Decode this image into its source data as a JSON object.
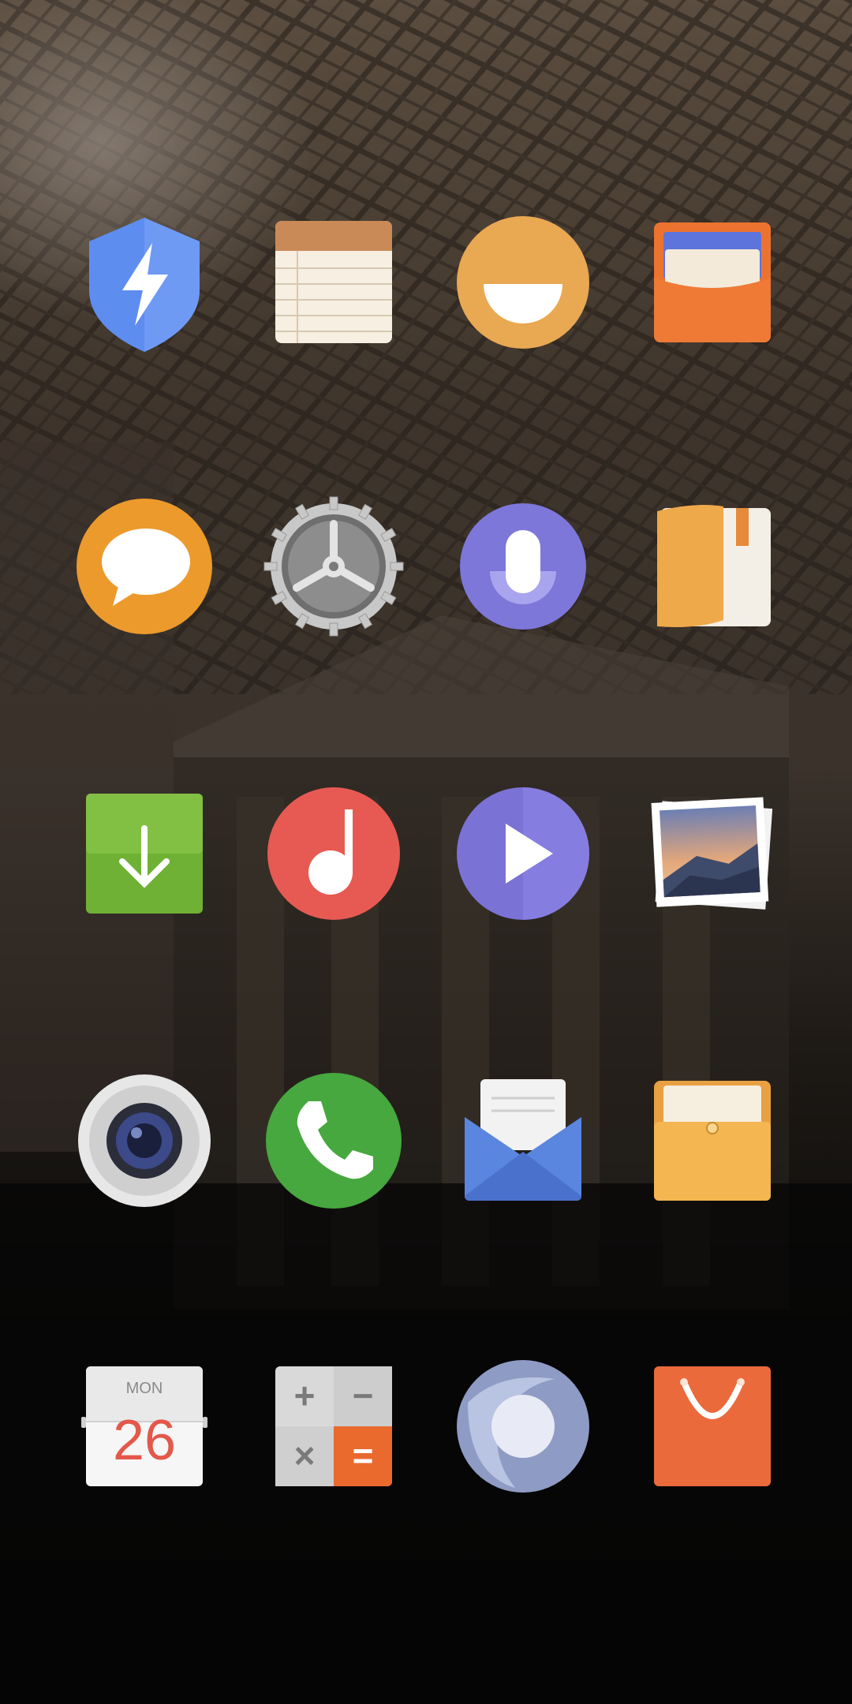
{
  "apps": [
    {
      "id": "security",
      "icon": "shield-lightning-icon"
    },
    {
      "id": "notes",
      "icon": "notepad-icon"
    },
    {
      "id": "theme-smile",
      "icon": "smile-icon"
    },
    {
      "id": "wallet",
      "icon": "wallet-cards-icon"
    },
    {
      "id": "messages",
      "icon": "speech-bubble-icon"
    },
    {
      "id": "settings",
      "icon": "gear-icon"
    },
    {
      "id": "voice-assistant",
      "icon": "microphone-icon"
    },
    {
      "id": "reader",
      "icon": "book-icon"
    },
    {
      "id": "downloads",
      "icon": "download-arrow-icon"
    },
    {
      "id": "music",
      "icon": "music-note-icon"
    },
    {
      "id": "video",
      "icon": "play-icon"
    },
    {
      "id": "gallery",
      "icon": "photo-stack-icon"
    },
    {
      "id": "camera",
      "icon": "camera-lens-icon"
    },
    {
      "id": "phone",
      "icon": "phone-handset-icon"
    },
    {
      "id": "email",
      "icon": "envelope-icon"
    },
    {
      "id": "file-manager",
      "icon": "folder-envelope-icon"
    },
    {
      "id": "calendar",
      "icon": "calendar-icon"
    },
    {
      "id": "calculator",
      "icon": "calculator-icon"
    },
    {
      "id": "browser",
      "icon": "globe-orbit-icon"
    },
    {
      "id": "app-store",
      "icon": "shopping-bag-icon"
    }
  ],
  "calendar": {
    "weekday": "MON",
    "day": "26"
  },
  "calculator": {
    "plus": "+",
    "minus": "−",
    "times": "×",
    "equals": "="
  },
  "colors": {
    "background_dark": "#0a0908",
    "security_blue": "#5e8df0",
    "notes_brown": "#c98a58",
    "smile_orange": "#e9a852",
    "wallet_orange": "#ec7230",
    "message_orange": "#ec9a2c",
    "voice_purple": "#7d77d9",
    "download_green": "#6fb134",
    "music_red": "#e75a53",
    "video_purple": "#7b72d6",
    "phone_green": "#46a83e",
    "mail_blue": "#5a86e0",
    "folder_yellow": "#f3b650",
    "calendar_red": "#e3584a",
    "calc_orange": "#ea6a2e",
    "store_orange": "#ea6a3b"
  }
}
